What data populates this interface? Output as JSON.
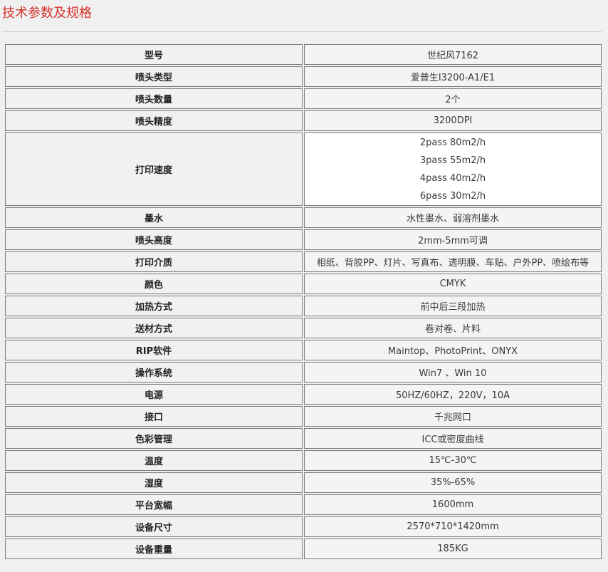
{
  "heading": "技术参数及规格",
  "rows": [
    {
      "label": "型号",
      "value": "世纪风7162"
    },
    {
      "label": "喷头类型",
      "value": "爱普生I3200-A1/E1"
    },
    {
      "label": "喷头数量",
      "value": "2个"
    },
    {
      "label": "喷头精度",
      "value": "3200DPI"
    },
    {
      "label": "打印速度",
      "values": [
        "2pass 80m2/h",
        "3pass 55m2/h",
        "4pass 40m2/h",
        "6pass 30m2/h"
      ]
    },
    {
      "label": "墨水",
      "value": "水性墨水、弱溶剂墨水"
    },
    {
      "label": "喷头高度",
      "value": "2mm-5mm可调"
    },
    {
      "label": "打印介质",
      "value": "相纸、背胶PP、灯片、写真布、透明膜、车贴、户外PP、喷绘布等"
    },
    {
      "label": "颜色",
      "value": "CMYK"
    },
    {
      "label": "加热方式",
      "value": "前中后三段加热"
    },
    {
      "label": "送材方式",
      "value": "卷对卷、片料"
    },
    {
      "label": "RIP软件",
      "value": "Maintop、PhotoPrint、ONYX"
    },
    {
      "label": "操作系统",
      "value": "Win7 、Win 10"
    },
    {
      "label": "电源",
      "value": "50HZ/60HZ，220V，10A"
    },
    {
      "label": "接口",
      "value": "千兆网口"
    },
    {
      "label": "色彩管理",
      "value": "ICC或密度曲线"
    },
    {
      "label": "温度",
      "value": "15℃-30℃"
    },
    {
      "label": "湿度",
      "value": "35%-65%"
    },
    {
      "label": "平台宽幅",
      "value": "1600mm"
    },
    {
      "label": "设备尺寸",
      "value": "2570*710*1420mm"
    },
    {
      "label": "设备重量",
      "value": "185KG"
    }
  ]
}
